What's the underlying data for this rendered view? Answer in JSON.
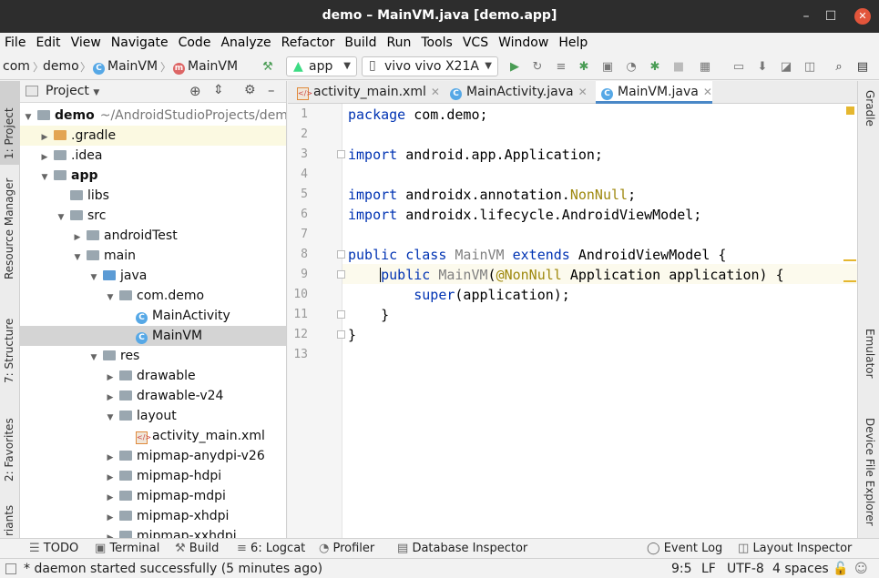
{
  "window": {
    "title": "demo – MainVM.java [demo.app]",
    "minimize": "–",
    "maximize": "☐",
    "close": "✕"
  },
  "menu": [
    "File",
    "Edit",
    "View",
    "Navigate",
    "Code",
    "Analyze",
    "Refactor",
    "Build",
    "Run",
    "Tools",
    "VCS",
    "Window",
    "Help"
  ],
  "breadcrumb": {
    "item1": "com",
    "item2": "demo",
    "item3": "MainVM",
    "item4": "MainVM"
  },
  "run_config": {
    "module": "app",
    "device": "vivo vivo X21A"
  },
  "left_tabs": {
    "project": "1: Project",
    "resource_manager": "Resource Manager",
    "structure": "7: Structure",
    "favorites": "2: Favorites",
    "variants": "riants"
  },
  "right_tabs": {
    "gradle": "Gradle",
    "emulator": "Emulator",
    "device_file_explorer": "Device File Explorer"
  },
  "project_panel": {
    "title": "Project"
  },
  "tree": [
    {
      "label": "demo",
      "suffix": "~/AndroidStudioProjects/demo",
      "depth": 0,
      "open": true,
      "icon": "folder-icon"
    },
    {
      "label": ".gradle",
      "depth": 1,
      "open": false,
      "icon": "folder-orange-icon"
    },
    {
      "label": ".idea",
      "depth": 1,
      "open": false,
      "icon": "folder-icon"
    },
    {
      "label": "app",
      "depth": 1,
      "open": true,
      "icon": "module-folder-icon"
    },
    {
      "label": "libs",
      "depth": 2,
      "open": null,
      "icon": "folder-icon"
    },
    {
      "label": "src",
      "depth": 2,
      "open": true,
      "icon": "folder-icon"
    },
    {
      "label": "androidTest",
      "depth": 3,
      "open": false,
      "icon": "folder-icon"
    },
    {
      "label": "main",
      "depth": 3,
      "open": true,
      "icon": "folder-icon"
    },
    {
      "label": "java",
      "depth": 4,
      "open": true,
      "icon": "source-folder-icon"
    },
    {
      "label": "com.demo",
      "depth": 5,
      "open": true,
      "icon": "package-icon"
    },
    {
      "label": "MainActivity",
      "depth": 6,
      "open": null,
      "icon": "class-icon"
    },
    {
      "label": "MainVM",
      "depth": 6,
      "open": null,
      "icon": "class-icon",
      "selected": true
    },
    {
      "label": "res",
      "depth": 4,
      "open": true,
      "icon": "resource-folder-icon"
    },
    {
      "label": "drawable",
      "depth": 5,
      "open": false,
      "icon": "folder-icon"
    },
    {
      "label": "drawable-v24",
      "depth": 5,
      "open": false,
      "icon": "folder-icon"
    },
    {
      "label": "layout",
      "depth": 5,
      "open": true,
      "icon": "folder-icon"
    },
    {
      "label": "activity_main.xml",
      "depth": 6,
      "open": null,
      "icon": "xml-file-icon"
    },
    {
      "label": "mipmap-anydpi-v26",
      "depth": 5,
      "open": false,
      "icon": "folder-icon"
    },
    {
      "label": "mipmap-hdpi",
      "depth": 5,
      "open": false,
      "icon": "folder-icon"
    },
    {
      "label": "mipmap-mdpi",
      "depth": 5,
      "open": false,
      "icon": "folder-icon"
    },
    {
      "label": "mipmap-xhdpi",
      "depth": 5,
      "open": false,
      "icon": "folder-icon"
    },
    {
      "label": "mipmap-xxhdpi",
      "depth": 5,
      "open": false,
      "icon": "folder-icon"
    }
  ],
  "editor_tabs": [
    {
      "label": "activity_main.xml",
      "icon": "xml-file-icon",
      "active": false
    },
    {
      "label": "MainActivity.java",
      "icon": "class-icon",
      "active": false
    },
    {
      "label": "MainVM.java",
      "icon": "class-icon",
      "active": true
    }
  ],
  "code": {
    "line_numbers": [
      "1",
      "2",
      "3",
      "4",
      "5",
      "6",
      "7",
      "8",
      "9",
      "10",
      "11",
      "12",
      "13"
    ],
    "lines": [
      [
        {
          "t": "package",
          "c": "kw"
        },
        {
          "t": " com.demo;"
        }
      ],
      [],
      [
        {
          "t": "import",
          "c": "kw"
        },
        {
          "t": " android.app.Application;"
        }
      ],
      [],
      [
        {
          "t": "import",
          "c": "kw"
        },
        {
          "t": " androidx.annotation."
        },
        {
          "t": "NonNull",
          "c": "an"
        },
        {
          "t": ";"
        }
      ],
      [
        {
          "t": "import",
          "c": "kw"
        },
        {
          "t": " androidx.lifecycle.AndroidViewModel;"
        }
      ],
      [],
      [
        {
          "t": "public class",
          "c": "kw"
        },
        {
          "t": " "
        },
        {
          "t": "MainVM",
          "c": "cls"
        },
        {
          "t": " "
        },
        {
          "t": "extends",
          "c": "kw"
        },
        {
          "t": " AndroidViewModel {"
        }
      ],
      [
        {
          "t": "    "
        },
        {
          "t": "public",
          "c": "kw"
        },
        {
          "t": " "
        },
        {
          "t": "MainVM",
          "c": "cls"
        },
        {
          "t": "("
        },
        {
          "t": "@NonNull",
          "c": "an"
        },
        {
          "t": " Application application) {"
        }
      ],
      [
        {
          "t": "        "
        },
        {
          "t": "super",
          "c": "kw"
        },
        {
          "t": "(application);"
        }
      ],
      [
        {
          "t": "    }"
        }
      ],
      [
        {
          "t": "}"
        }
      ],
      []
    ]
  },
  "bottom_tools": {
    "todo": "TODO",
    "terminal": "Terminal",
    "build": "Build",
    "logcat": "6: Logcat",
    "profiler": "Profiler",
    "database": "Database Inspector",
    "event_log": "Event Log",
    "layout_inspector": "Layout Inspector"
  },
  "status": {
    "message": "* daemon started successfully (5 minutes ago)",
    "position": "9:5",
    "line_sep": "LF",
    "encoding": "UTF-8",
    "indent": "4 spaces"
  }
}
